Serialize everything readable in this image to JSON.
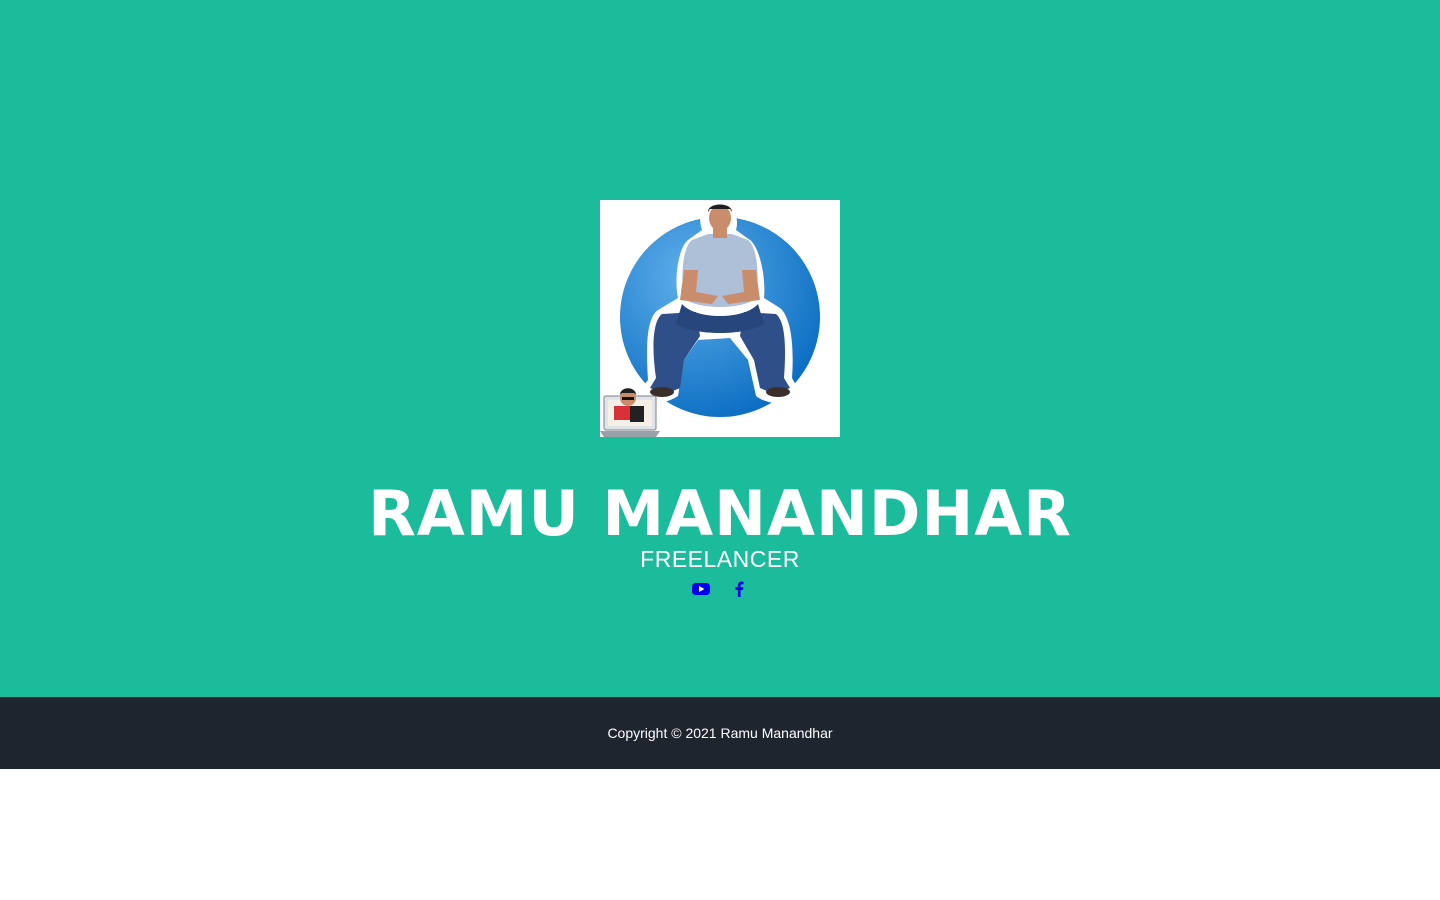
{
  "profile": {
    "name": "RAMU MANANDHAR",
    "title": "FREELANCER",
    "avatar_icon": "profile-photo"
  },
  "social": {
    "links": [
      {
        "icon": "youtube-icon",
        "color": "#0000ee"
      },
      {
        "icon": "facebook-icon",
        "color": "#0000ee"
      }
    ]
  },
  "footer": {
    "copyright": "Copyright © 2021 Ramu Manandhar"
  },
  "colors": {
    "hero_bg": "#1abc9c",
    "footer_bg": "#1e252f",
    "text": "#ffffff",
    "link": "#0000ee"
  }
}
